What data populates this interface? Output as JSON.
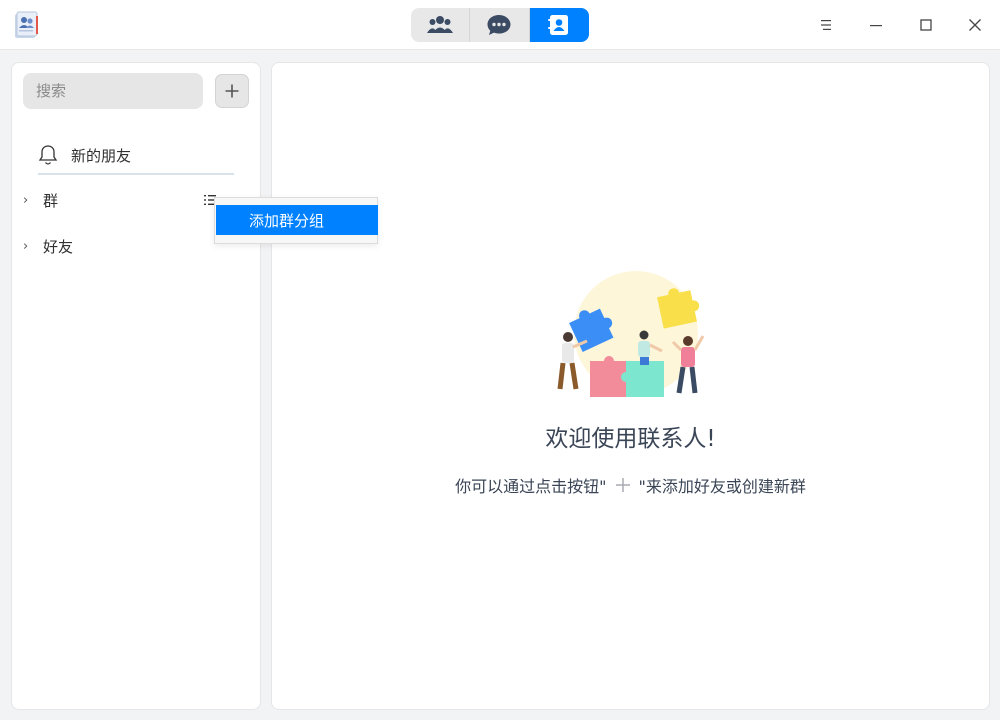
{
  "titlebar": {
    "app_icon": "contacts-app-icon",
    "tabs": [
      {
        "icon": "group-icon",
        "active": false
      },
      {
        "icon": "chat-icon",
        "active": false
      },
      {
        "icon": "contacts-icon",
        "active": true
      }
    ],
    "window_controls": [
      "menu-icon",
      "minimize-icon",
      "maximize-icon",
      "close-icon"
    ],
    "accent": "#0081ff"
  },
  "sidebar": {
    "search": {
      "placeholder": "搜索",
      "value": ""
    },
    "add_icon": "plus-icon",
    "new_friends": {
      "icon": "bell-icon",
      "label": "新的朋友"
    },
    "groups": [
      {
        "label": "群",
        "expanded": false
      },
      {
        "label": "好友",
        "expanded": false
      }
    ]
  },
  "context_menu": {
    "items": [
      {
        "label": "添加群分组",
        "selected": true
      }
    ]
  },
  "main": {
    "illustration": "puzzle-team-illustration",
    "welcome": "欢迎使用联系人!",
    "hint_before": "你可以通过点击按钮\"",
    "hint_after": "\"来添加好友或创建新群"
  }
}
